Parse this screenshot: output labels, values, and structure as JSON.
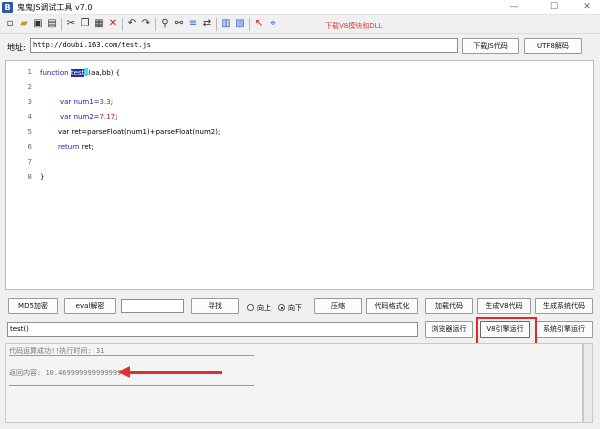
{
  "window": {
    "title": "鬼鬼JS调试工具 v7.0",
    "app_icon_letter": "B",
    "minimize": "—",
    "maximize": "☐",
    "close": "✕"
  },
  "toolbar": {
    "icons": [
      "new-file-icon",
      "open-folder-icon",
      "save-icon",
      "save-as-icon",
      "cut-icon",
      "copy-icon",
      "paste-icon",
      "delete-icon",
      "undo-icon",
      "redo-icon",
      "find-icon",
      "find-next-icon",
      "format-icon",
      "replace-icon",
      "settings-icon",
      "select-all-icon",
      "help-icon",
      "pin-icon"
    ],
    "download_link": "下载V8模块和DLL"
  },
  "address": {
    "label": "地址:",
    "value": "http://doubi.163.com/test.js",
    "download_js_button": "下载JS代码",
    "utf8_decode_button": "UTF8解码"
  },
  "editor": {
    "line_numbers": [
      "1",
      "2",
      "3",
      "4",
      "5",
      "6",
      "7",
      "8"
    ],
    "line1_keyword": "function",
    "line1_fname": "test",
    "line1_params": "(aa,bb) {",
    "line3_decl": "var num1=",
    "line3_value": "3.3",
    "line3_end": ";",
    "line4_decl": "var num2=",
    "line4_value": "7.17",
    "line4_end": ";",
    "line5": "var ret=parseFloat(num1)+parseFloat(num2);",
    "line6_keyword": "return",
    "line6_rest": " ret;",
    "line8": "}"
  },
  "controls": {
    "md5_button": "MD5加密",
    "eval_button": "eval解密",
    "search_value": "",
    "find_button": "寻找",
    "radio_up": "向上",
    "radio_down": "向下",
    "compress_button": "压缩",
    "format_button": "代码格式化",
    "load_button": "加载代码",
    "gen_v8_button": "生成V8代码",
    "gen_system_button": "生成系统代码",
    "command_value": "test()",
    "browser_run_button": "浏览器运行",
    "v8_run_button": "V8引擎运行",
    "system_run_button": "系统引擎运行"
  },
  "output": {
    "status": "代码运算成功!!执行时间: 31",
    "result_label": "返回内容:",
    "result_value": "10.469999999999999"
  },
  "colors": {
    "selection": "#1b2fb0",
    "keyword": "#1a1aa6",
    "number": "#c41a1a",
    "annotation": "#e02a2a"
  }
}
